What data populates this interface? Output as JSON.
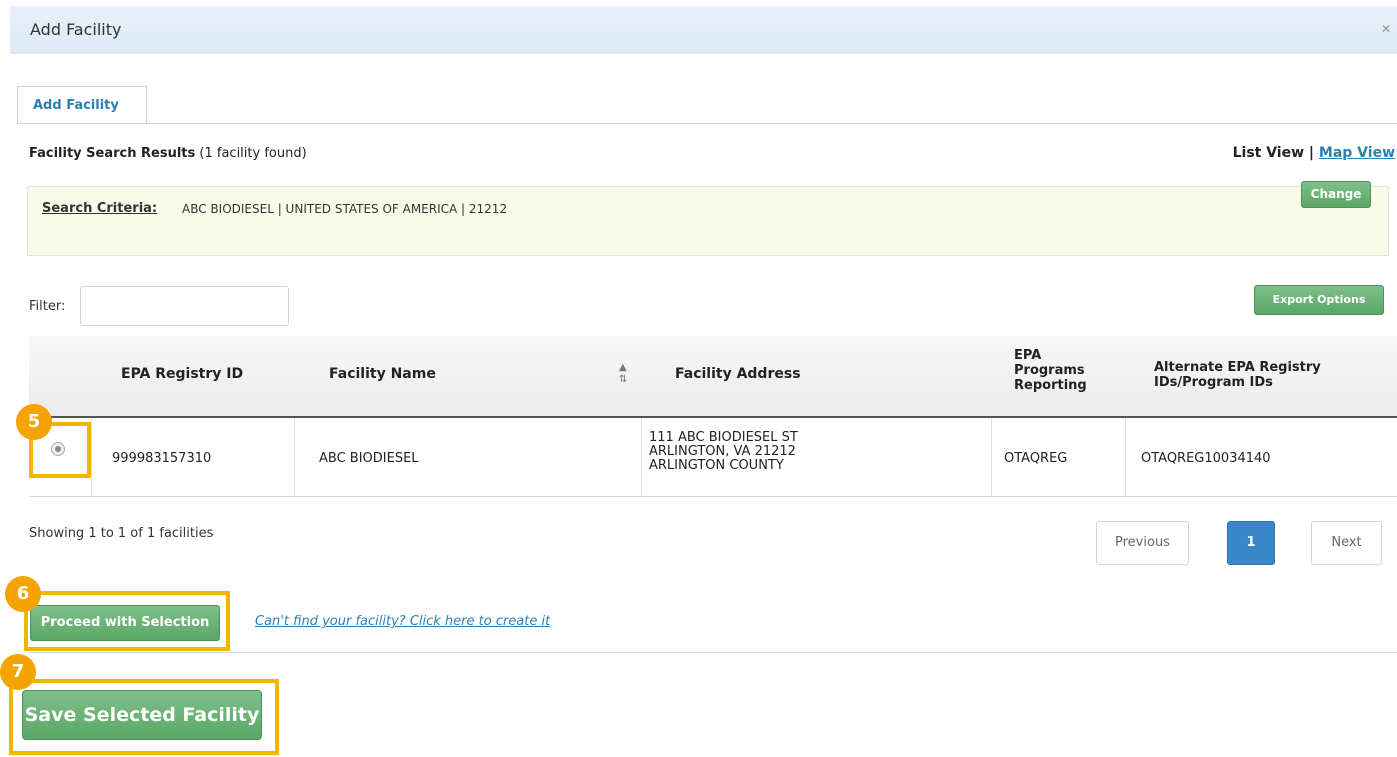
{
  "window": {
    "title": "Add Facility",
    "close_glyph": "✕"
  },
  "tab": {
    "label": "Add Facility"
  },
  "results": {
    "label": "Facility Search Results",
    "count_text": "(1 facility found)"
  },
  "views": {
    "list": "List View",
    "separator": "|",
    "map": "Map View"
  },
  "criteria": {
    "label": "Search Criteria:",
    "value": "ABC BIODIESEL | UNITED STATES OF AMERICA | 21212",
    "change_button": "Change"
  },
  "filter": {
    "label": "Filter:",
    "value": ""
  },
  "export_button": "Export Options",
  "table": {
    "headers": [
      "EPA Registry ID",
      "Facility Name",
      "Facility Address",
      "EPA Programs Reporting",
      "Alternate EPA Registry IDs/Program IDs"
    ],
    "rows": [
      {
        "selected": true,
        "registry_id": "999983157310",
        "name": "ABC BIODIESEL",
        "address_line1": "111 ABC BIODIESEL ST",
        "address_line2": "ARLINGTON, VA 21212",
        "address_line3": "ARLINGTON COUNTY",
        "programs": "OTAQREG",
        "alt_ids": "OTAQREG10034140"
      }
    ]
  },
  "pagination": {
    "summary": "Showing 1 to 1 of 1 facilities",
    "previous": "Previous",
    "current": "1",
    "next": "Next"
  },
  "actions": {
    "proceed": "Proceed with Selection",
    "create_link": "Can't find your facility? Click here to create it",
    "save": "Save Selected Facility"
  },
  "annotations": {
    "step5": "5",
    "step6": "6",
    "step7": "7",
    "highlight_color": "#f5b400"
  }
}
